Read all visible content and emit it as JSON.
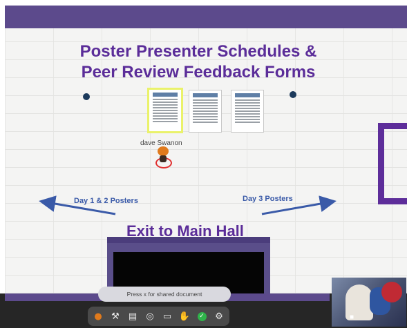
{
  "scene": {
    "title_line1": "Poster Presenter Schedules &",
    "title_line2": "Peer Review Feedback Forms",
    "player_name": "dave Swanon",
    "arrow_left_label": "Day 1 & 2 Posters",
    "arrow_right_label": "Day 3 Posters",
    "exit_label": "Exit to Main Hall",
    "documents": [
      "document-1",
      "document-2",
      "document-3"
    ]
  },
  "bottom": {
    "tooltip": "Press x for shared document",
    "toolbar": [
      {
        "name": "avatar-icon",
        "glyph": "●"
      },
      {
        "name": "build-hammer-icon",
        "glyph": "⚒"
      },
      {
        "name": "map-icon",
        "glyph": "▤"
      },
      {
        "name": "target-icon",
        "glyph": "◎"
      },
      {
        "name": "screen-share-icon",
        "glyph": "▭"
      },
      {
        "name": "hand-raise-icon",
        "glyph": "✋"
      },
      {
        "name": "status-check-icon",
        "glyph": "✓"
      },
      {
        "name": "settings-gear-icon",
        "glyph": "⚙"
      }
    ]
  },
  "colors": {
    "title_purple": "#5b2d99",
    "accent_band": "#5c4a8c",
    "arrow_blue": "#3a5aa8"
  }
}
